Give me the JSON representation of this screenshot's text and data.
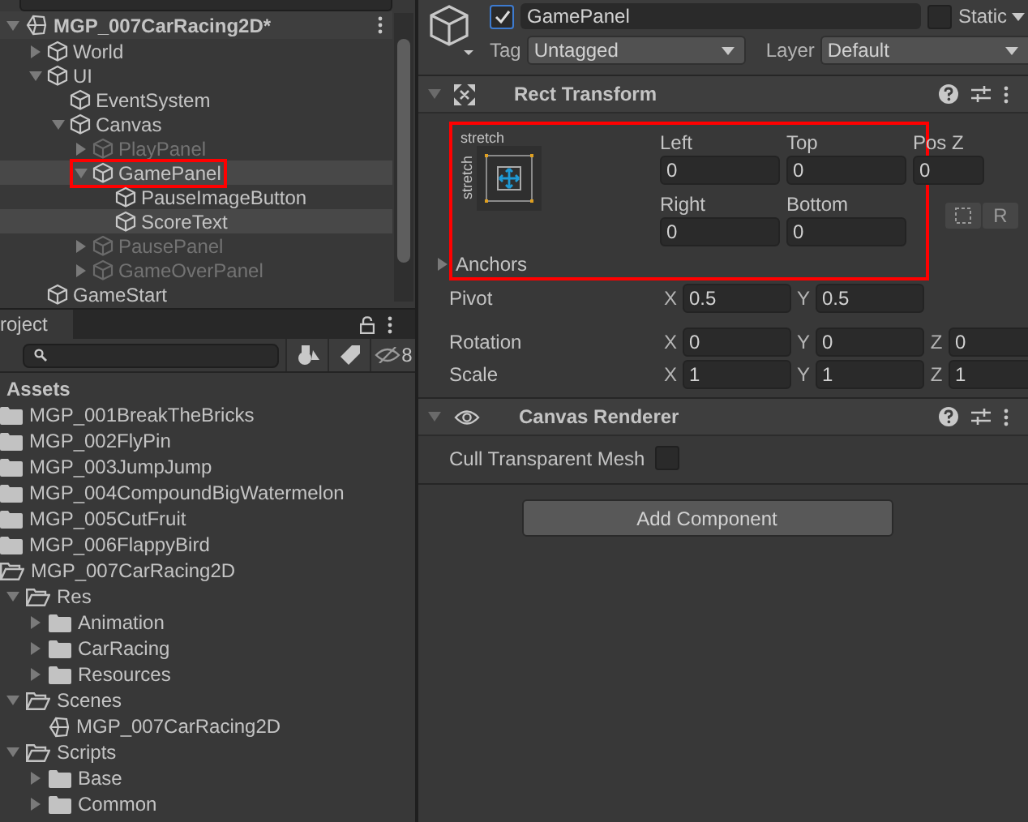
{
  "hierarchy": {
    "scene": "MGP_007CarRacing2D*",
    "items": [
      {
        "label": "World",
        "kind": "collapsed",
        "disabled": false,
        "selected": false,
        "marked": false
      },
      {
        "label": "UI",
        "kind": "expanded",
        "disabled": false,
        "selected": false,
        "marked": false,
        "children": [
          {
            "label": "EventSystem",
            "kind": "leaf",
            "disabled": false,
            "selected": false,
            "marked": false
          },
          {
            "label": "Canvas",
            "kind": "expanded",
            "disabled": false,
            "selected": false,
            "marked": false,
            "children": [
              {
                "label": "PlayPanel",
                "kind": "collapsed",
                "disabled": true,
                "selected": false,
                "marked": false
              },
              {
                "label": "GamePanel",
                "kind": "expanded",
                "disabled": false,
                "selected": true,
                "marked": true,
                "children": [
                  {
                    "label": "PauseImageButton",
                    "kind": "leaf",
                    "disabled": false,
                    "selected": false,
                    "marked": false
                  },
                  {
                    "label": "ScoreText",
                    "kind": "leaf",
                    "disabled": false,
                    "selected": true,
                    "marked": false
                  }
                ]
              },
              {
                "label": "PausePanel",
                "kind": "collapsed",
                "disabled": true,
                "selected": false,
                "marked": false
              },
              {
                "label": "GameOverPanel",
                "kind": "collapsed",
                "disabled": true,
                "selected": false,
                "marked": false
              }
            ]
          }
        ]
      },
      {
        "label": "GameStart",
        "kind": "leaf",
        "disabled": false,
        "selected": false,
        "marked": false
      }
    ]
  },
  "project": {
    "tab": "roject",
    "filter_count": "8",
    "root": "Assets",
    "items": [
      {
        "label": "MGP_001BreakTheBricks",
        "kind": "folder"
      },
      {
        "label": "MGP_002FlyPin",
        "kind": "folder"
      },
      {
        "label": "MGP_003JumpJump",
        "kind": "folder"
      },
      {
        "label": "MGP_004CompoundBigWatermelon",
        "kind": "folder"
      },
      {
        "label": "MGP_005CutFruit",
        "kind": "folder"
      },
      {
        "label": "MGP_006FlappyBird",
        "kind": "folder"
      },
      {
        "label": "MGP_007CarRacing2D",
        "kind": "open-folder",
        "children": [
          {
            "label": "Res",
            "kind": "open-folder",
            "children": [
              {
                "label": "Animation",
                "kind": "folder"
              },
              {
                "label": "CarRacing",
                "kind": "folder"
              },
              {
                "label": "Resources",
                "kind": "folder"
              }
            ]
          },
          {
            "label": "Scenes",
            "kind": "open-folder",
            "children": [
              {
                "label": "MGP_007CarRacing2D",
                "kind": "scene"
              }
            ]
          },
          {
            "label": "Scripts",
            "kind": "open-folder",
            "children": [
              {
                "label": "Base",
                "kind": "folder"
              },
              {
                "label": "Common",
                "kind": "folder"
              }
            ]
          }
        ]
      }
    ]
  },
  "inspector": {
    "active": true,
    "name": "GamePanel",
    "static": false,
    "static_label": "Static",
    "tag_label": "Tag",
    "tag": "Untagged",
    "layer_label": "Layer",
    "layer": "Default",
    "rect_transform": {
      "title": "Rect Transform",
      "marked": true,
      "anchor_h": "stretch",
      "anchor_v": "stretch",
      "fields": [
        {
          "label": "Left",
          "value": "0"
        },
        {
          "label": "Top",
          "value": "0"
        },
        {
          "label": "Pos Z",
          "value": "0"
        },
        {
          "label": "Right",
          "value": "0"
        },
        {
          "label": "Bottom",
          "value": "0"
        }
      ],
      "r_button": "R",
      "anchors": "Anchors",
      "vectors": [
        {
          "label": "Pivot",
          "values": [
            {
              "axis": "X",
              "value": "0.5"
            },
            {
              "axis": "Y",
              "value": "0.5"
            }
          ]
        },
        {
          "label": "Rotation",
          "values": [
            {
              "axis": "X",
              "value": "0"
            },
            {
              "axis": "Y",
              "value": "0"
            },
            {
              "axis": "Z",
              "value": "0"
            }
          ]
        },
        {
          "label": "Scale",
          "values": [
            {
              "axis": "X",
              "value": "1"
            },
            {
              "axis": "Y",
              "value": "1"
            },
            {
              "axis": "Z",
              "value": "1"
            }
          ]
        }
      ]
    },
    "canvas_renderer": {
      "title": "Canvas Renderer",
      "option": "Cull Transparent Mesh",
      "checked": false
    },
    "add_button": "Add Component"
  }
}
